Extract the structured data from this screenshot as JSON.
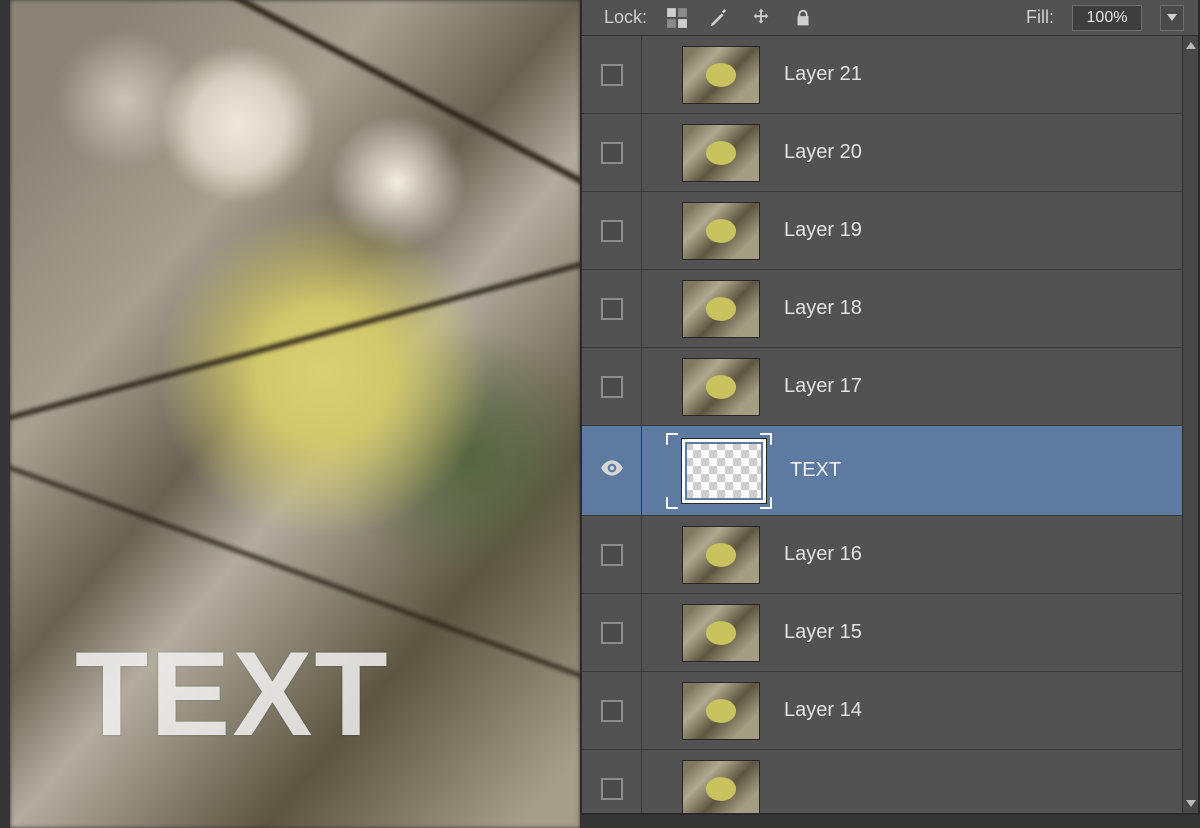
{
  "canvas": {
    "overlay_text": "TEXT"
  },
  "lock_bar": {
    "lock_label": "Lock:",
    "fill_label": "Fill:",
    "fill_value": "100%",
    "icons": {
      "transparency": "lock-transparent-icon",
      "brush": "lock-brush-icon",
      "move": "lock-move-icon",
      "lock": "lock-all-icon"
    }
  },
  "layers": [
    {
      "name": "Layer 21",
      "visible": false,
      "selected": false,
      "thumb": "photo"
    },
    {
      "name": "Layer 20",
      "visible": false,
      "selected": false,
      "thumb": "photo"
    },
    {
      "name": "Layer 19",
      "visible": false,
      "selected": false,
      "thumb": "photo"
    },
    {
      "name": "Layer 18",
      "visible": false,
      "selected": false,
      "thumb": "photo"
    },
    {
      "name": "Layer 17",
      "visible": false,
      "selected": false,
      "thumb": "photo"
    },
    {
      "name": "TEXT",
      "visible": true,
      "selected": true,
      "thumb": "transparent"
    },
    {
      "name": "Layer 16",
      "visible": false,
      "selected": false,
      "thumb": "photo"
    },
    {
      "name": "Layer 15",
      "visible": false,
      "selected": false,
      "thumb": "photo"
    },
    {
      "name": "Layer 14",
      "visible": false,
      "selected": false,
      "thumb": "photo"
    },
    {
      "name": "",
      "visible": false,
      "selected": false,
      "thumb": "photo"
    }
  ]
}
